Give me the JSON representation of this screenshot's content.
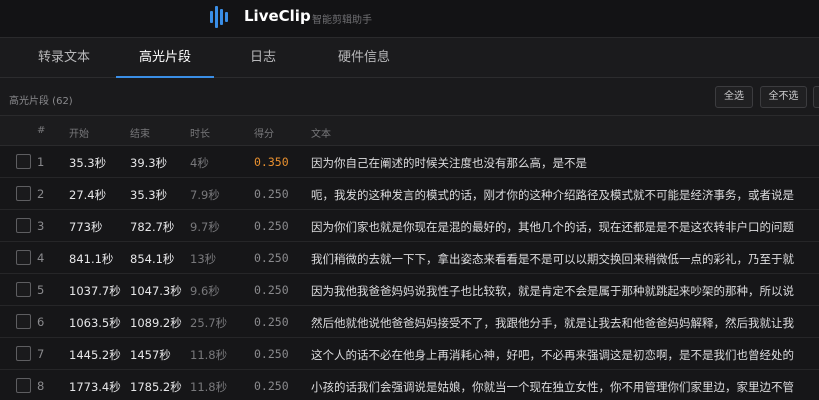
{
  "app": {
    "name": "LiveClip",
    "slogan": "智能剪辑助手",
    "accent_color": "#3a8ee6",
    "logo_icon": "audio-bars-icon"
  },
  "tabs": [
    {
      "label": "转录文本",
      "active": false
    },
    {
      "label": "高光片段",
      "active": true
    },
    {
      "label": "日志",
      "active": false
    },
    {
      "label": "硬件信息",
      "active": false
    }
  ],
  "section": {
    "title": "高光片段 (62)",
    "select_all": "全选",
    "select_none": "全不选"
  },
  "table": {
    "headers": [
      "#",
      "开始",
      "结束",
      "时长",
      "得分",
      "文本"
    ],
    "rows": [
      {
        "idx": "1",
        "start": "35.3秒",
        "end": "39.3秒",
        "dur": "4秒",
        "score": "0.350",
        "highlight": true,
        "text": "因为你自己在阐述的时候关注度也没有那么高，是不是"
      },
      {
        "idx": "2",
        "start": "27.4秒",
        "end": "35.3秒",
        "dur": "7.9秒",
        "score": "0.250",
        "highlight": false,
        "text": "呃，我发的这种发言的模式的话，刚才你的这种介绍路径及模式就不可能是经济事务，或者说是"
      },
      {
        "idx": "3",
        "start": "773秒",
        "end": "782.7秒",
        "dur": "9.7秒",
        "score": "0.250",
        "highlight": false,
        "text": "因为你们家也就是你现在是混的最好的，其他几个的话，现在还都是是不是这农转非户口的问题"
      },
      {
        "idx": "4",
        "start": "841.1秒",
        "end": "854.1秒",
        "dur": "13秒",
        "score": "0.250",
        "highlight": false,
        "text": "我们稍微的去就一下下，拿出姿态来看看是不是可以以期交换回来稍微低一点的彩礼，乃至于就"
      },
      {
        "idx": "5",
        "start": "1037.7秒",
        "end": "1047.3秒",
        "dur": "9.6秒",
        "score": "0.250",
        "highlight": false,
        "text": "因为我他我爸爸妈妈说我性子也比较软，就是肯定不会是属于那种就跳起来吵架的那种，所以说"
      },
      {
        "idx": "6",
        "start": "1063.5秒",
        "end": "1089.2秒",
        "dur": "25.7秒",
        "score": "0.250",
        "highlight": false,
        "text": "然后他就他说他爸爸妈妈接受不了，我跟他分手，就是让我去和他爸爸妈妈解释，然后我就让我"
      },
      {
        "idx": "7",
        "start": "1445.2秒",
        "end": "1457秒",
        "dur": "11.8秒",
        "score": "0.250",
        "highlight": false,
        "text": "这个人的话不必在他身上再消耗心神，好吧，不必再来强调这是初恋啊，是不是我们也曾经处的"
      },
      {
        "idx": "8",
        "start": "1773.4秒",
        "end": "1785.2秒",
        "dur": "11.8秒",
        "score": "0.250",
        "highlight": false,
        "text": "小孩的话我们会强调说是姑娘，你就当一个现在独立女性，你不用管理你们家里边，家里边不管"
      }
    ]
  }
}
